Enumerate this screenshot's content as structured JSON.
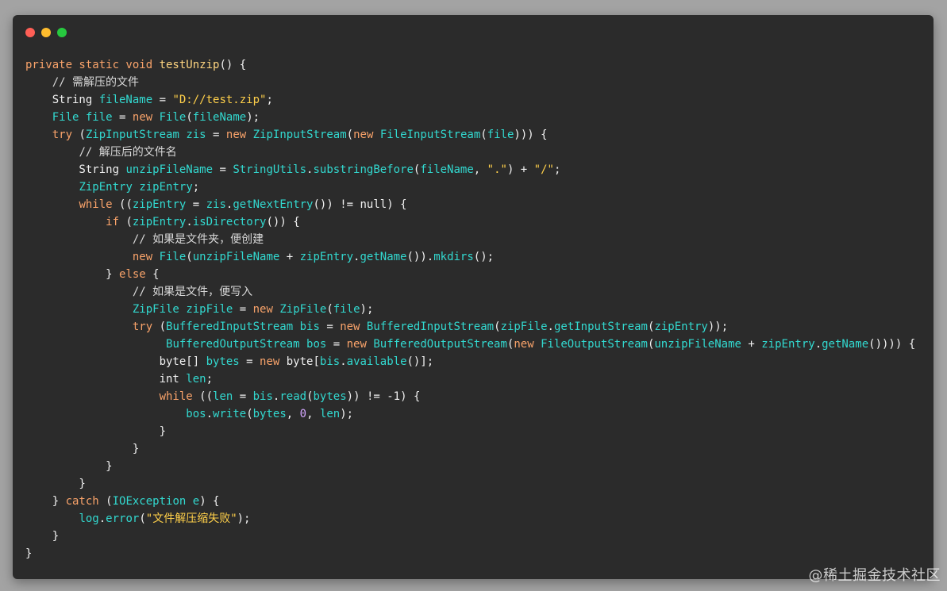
{
  "window": {
    "controls": [
      {
        "name": "close",
        "color": "#ff5f56"
      },
      {
        "name": "minimize",
        "color": "#ffbd2e"
      },
      {
        "name": "maximize",
        "color": "#27c93f"
      }
    ]
  },
  "code": {
    "lines": [
      [
        {
          "t": "keyword",
          "v": "private static void "
        },
        {
          "t": "function",
          "v": "testUnzip"
        },
        {
          "t": "plain",
          "v": "() {"
        }
      ],
      [
        {
          "t": "plain",
          "v": "    "
        },
        {
          "t": "comment",
          "v": "// 需解压的文件"
        }
      ],
      [
        {
          "t": "plain",
          "v": "    String "
        },
        {
          "t": "variable",
          "v": "fileName"
        },
        {
          "t": "plain",
          "v": " = "
        },
        {
          "t": "string",
          "v": "\"D://test.zip\""
        },
        {
          "t": "plain",
          "v": ";"
        }
      ],
      [
        {
          "t": "plain",
          "v": "    "
        },
        {
          "t": "type",
          "v": "File"
        },
        {
          "t": "plain",
          "v": " "
        },
        {
          "t": "variable",
          "v": "file"
        },
        {
          "t": "plain",
          "v": " = "
        },
        {
          "t": "keyword",
          "v": "new "
        },
        {
          "t": "type",
          "v": "File"
        },
        {
          "t": "plain",
          "v": "("
        },
        {
          "t": "variable",
          "v": "fileName"
        },
        {
          "t": "plain",
          "v": ");"
        }
      ],
      [
        {
          "t": "plain",
          "v": "    "
        },
        {
          "t": "keyword",
          "v": "try "
        },
        {
          "t": "plain",
          "v": "("
        },
        {
          "t": "type",
          "v": "ZipInputStream"
        },
        {
          "t": "plain",
          "v": " "
        },
        {
          "t": "variable",
          "v": "zis"
        },
        {
          "t": "plain",
          "v": " = "
        },
        {
          "t": "keyword",
          "v": "new "
        },
        {
          "t": "type",
          "v": "ZipInputStream"
        },
        {
          "t": "plain",
          "v": "("
        },
        {
          "t": "keyword",
          "v": "new "
        },
        {
          "t": "type",
          "v": "FileInputStream"
        },
        {
          "t": "plain",
          "v": "("
        },
        {
          "t": "variable",
          "v": "file"
        },
        {
          "t": "plain",
          "v": "))) {"
        }
      ],
      [
        {
          "t": "plain",
          "v": "        "
        },
        {
          "t": "comment",
          "v": "// 解压后的文件名"
        }
      ],
      [
        {
          "t": "plain",
          "v": "        String "
        },
        {
          "t": "variable",
          "v": "unzipFileName"
        },
        {
          "t": "plain",
          "v": " = "
        },
        {
          "t": "type",
          "v": "StringUtils"
        },
        {
          "t": "plain",
          "v": "."
        },
        {
          "t": "variable",
          "v": "substringBefore"
        },
        {
          "t": "plain",
          "v": "("
        },
        {
          "t": "variable",
          "v": "fileName"
        },
        {
          "t": "plain",
          "v": ", "
        },
        {
          "t": "string",
          "v": "\".\""
        },
        {
          "t": "plain",
          "v": ") + "
        },
        {
          "t": "string",
          "v": "\"/\""
        },
        {
          "t": "plain",
          "v": ";"
        }
      ],
      [
        {
          "t": "plain",
          "v": "        "
        },
        {
          "t": "type",
          "v": "ZipEntry"
        },
        {
          "t": "plain",
          "v": " "
        },
        {
          "t": "variable",
          "v": "zipEntry"
        },
        {
          "t": "plain",
          "v": ";"
        }
      ],
      [
        {
          "t": "plain",
          "v": "        "
        },
        {
          "t": "keyword",
          "v": "while "
        },
        {
          "t": "plain",
          "v": "(("
        },
        {
          "t": "variable",
          "v": "zipEntry"
        },
        {
          "t": "plain",
          "v": " = "
        },
        {
          "t": "variable",
          "v": "zis"
        },
        {
          "t": "plain",
          "v": "."
        },
        {
          "t": "variable",
          "v": "getNextEntry"
        },
        {
          "t": "plain",
          "v": "()) != null) {"
        }
      ],
      [
        {
          "t": "plain",
          "v": "            "
        },
        {
          "t": "keyword",
          "v": "if "
        },
        {
          "t": "plain",
          "v": "("
        },
        {
          "t": "variable",
          "v": "zipEntry"
        },
        {
          "t": "plain",
          "v": "."
        },
        {
          "t": "variable",
          "v": "isDirectory"
        },
        {
          "t": "plain",
          "v": "()) {"
        }
      ],
      [
        {
          "t": "plain",
          "v": "                "
        },
        {
          "t": "comment",
          "v": "// 如果是文件夹，便创建"
        }
      ],
      [
        {
          "t": "plain",
          "v": "                "
        },
        {
          "t": "keyword",
          "v": "new "
        },
        {
          "t": "type",
          "v": "File"
        },
        {
          "t": "plain",
          "v": "("
        },
        {
          "t": "variable",
          "v": "unzipFileName"
        },
        {
          "t": "plain",
          "v": " + "
        },
        {
          "t": "variable",
          "v": "zipEntry"
        },
        {
          "t": "plain",
          "v": "."
        },
        {
          "t": "variable",
          "v": "getName"
        },
        {
          "t": "plain",
          "v": "())."
        },
        {
          "t": "variable",
          "v": "mkdirs"
        },
        {
          "t": "plain",
          "v": "();"
        }
      ],
      [
        {
          "t": "plain",
          "v": "            } "
        },
        {
          "t": "keyword",
          "v": "else"
        },
        {
          "t": "plain",
          "v": " {"
        }
      ],
      [
        {
          "t": "plain",
          "v": "                "
        },
        {
          "t": "comment",
          "v": "// 如果是文件，便写入"
        }
      ],
      [
        {
          "t": "plain",
          "v": "                "
        },
        {
          "t": "type",
          "v": "ZipFile"
        },
        {
          "t": "plain",
          "v": " "
        },
        {
          "t": "variable",
          "v": "zipFile"
        },
        {
          "t": "plain",
          "v": " = "
        },
        {
          "t": "keyword",
          "v": "new "
        },
        {
          "t": "type",
          "v": "ZipFile"
        },
        {
          "t": "plain",
          "v": "("
        },
        {
          "t": "variable",
          "v": "file"
        },
        {
          "t": "plain",
          "v": ");"
        }
      ],
      [
        {
          "t": "plain",
          "v": "                "
        },
        {
          "t": "keyword",
          "v": "try "
        },
        {
          "t": "plain",
          "v": "("
        },
        {
          "t": "type",
          "v": "BufferedInputStream"
        },
        {
          "t": "plain",
          "v": " "
        },
        {
          "t": "variable",
          "v": "bis"
        },
        {
          "t": "plain",
          "v": " = "
        },
        {
          "t": "keyword",
          "v": "new "
        },
        {
          "t": "type",
          "v": "BufferedInputStream"
        },
        {
          "t": "plain",
          "v": "("
        },
        {
          "t": "variable",
          "v": "zipFile"
        },
        {
          "t": "plain",
          "v": "."
        },
        {
          "t": "variable",
          "v": "getInputStream"
        },
        {
          "t": "plain",
          "v": "("
        },
        {
          "t": "variable",
          "v": "zipEntry"
        },
        {
          "t": "plain",
          "v": "));"
        }
      ],
      [
        {
          "t": "plain",
          "v": "                     "
        },
        {
          "t": "type",
          "v": "BufferedOutputStream"
        },
        {
          "t": "plain",
          "v": " "
        },
        {
          "t": "variable",
          "v": "bos"
        },
        {
          "t": "plain",
          "v": " = "
        },
        {
          "t": "keyword",
          "v": "new "
        },
        {
          "t": "type",
          "v": "BufferedOutputStream"
        },
        {
          "t": "plain",
          "v": "("
        },
        {
          "t": "keyword",
          "v": "new "
        },
        {
          "t": "type",
          "v": "FileOutputStream"
        },
        {
          "t": "plain",
          "v": "("
        },
        {
          "t": "variable",
          "v": "unzipFileName"
        },
        {
          "t": "plain",
          "v": " + "
        },
        {
          "t": "variable",
          "v": "zipEntry"
        },
        {
          "t": "plain",
          "v": "."
        },
        {
          "t": "variable",
          "v": "getName"
        },
        {
          "t": "plain",
          "v": "()))) {"
        }
      ],
      [
        {
          "t": "plain",
          "v": "                    byte[] "
        },
        {
          "t": "variable",
          "v": "bytes"
        },
        {
          "t": "plain",
          "v": " = "
        },
        {
          "t": "keyword",
          "v": "new "
        },
        {
          "t": "plain",
          "v": "byte["
        },
        {
          "t": "variable",
          "v": "bis"
        },
        {
          "t": "plain",
          "v": "."
        },
        {
          "t": "variable",
          "v": "available"
        },
        {
          "t": "plain",
          "v": "()];"
        }
      ],
      [
        {
          "t": "plain",
          "v": "                    int "
        },
        {
          "t": "variable",
          "v": "len"
        },
        {
          "t": "plain",
          "v": ";"
        }
      ],
      [
        {
          "t": "plain",
          "v": "                    "
        },
        {
          "t": "keyword",
          "v": "while "
        },
        {
          "t": "plain",
          "v": "(("
        },
        {
          "t": "variable",
          "v": "len"
        },
        {
          "t": "plain",
          "v": " = "
        },
        {
          "t": "variable",
          "v": "bis"
        },
        {
          "t": "plain",
          "v": "."
        },
        {
          "t": "variable",
          "v": "read"
        },
        {
          "t": "plain",
          "v": "("
        },
        {
          "t": "variable",
          "v": "bytes"
        },
        {
          "t": "plain",
          "v": ")) != -1) {"
        }
      ],
      [
        {
          "t": "plain",
          "v": "                        "
        },
        {
          "t": "variable",
          "v": "bos"
        },
        {
          "t": "plain",
          "v": "."
        },
        {
          "t": "variable",
          "v": "write"
        },
        {
          "t": "plain",
          "v": "("
        },
        {
          "t": "variable",
          "v": "bytes"
        },
        {
          "t": "plain",
          "v": ", "
        },
        {
          "t": "number",
          "v": "0"
        },
        {
          "t": "plain",
          "v": ", "
        },
        {
          "t": "variable",
          "v": "len"
        },
        {
          "t": "plain",
          "v": ");"
        }
      ],
      [
        {
          "t": "plain",
          "v": "                    }"
        }
      ],
      [
        {
          "t": "plain",
          "v": "                }"
        }
      ],
      [
        {
          "t": "plain",
          "v": "            }"
        }
      ],
      [
        {
          "t": "plain",
          "v": "        }"
        }
      ],
      [
        {
          "t": "plain",
          "v": "    } "
        },
        {
          "t": "keyword",
          "v": "catch "
        },
        {
          "t": "plain",
          "v": "("
        },
        {
          "t": "type",
          "v": "IOException"
        },
        {
          "t": "plain",
          "v": " "
        },
        {
          "t": "variable",
          "v": "e"
        },
        {
          "t": "plain",
          "v": ") {"
        }
      ],
      [
        {
          "t": "plain",
          "v": "        "
        },
        {
          "t": "variable",
          "v": "log"
        },
        {
          "t": "plain",
          "v": "."
        },
        {
          "t": "variable",
          "v": "error"
        },
        {
          "t": "plain",
          "v": "("
        },
        {
          "t": "string",
          "v": "\"文件解压缩失败\""
        },
        {
          "t": "plain",
          "v": ");"
        }
      ],
      [
        {
          "t": "plain",
          "v": "    }"
        }
      ],
      [
        {
          "t": "plain",
          "v": "}"
        }
      ]
    ]
  },
  "watermark": {
    "text": "@稀土掘金技术社区"
  }
}
